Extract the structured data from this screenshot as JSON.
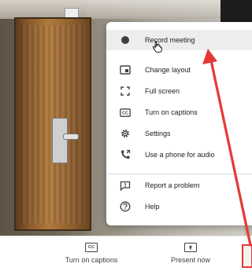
{
  "menu": {
    "items": [
      {
        "label": "Record meeting",
        "icon": "record-dot-icon"
      },
      {
        "label": "Change layout",
        "icon": "layout-icon"
      },
      {
        "label": "Full screen",
        "icon": "fullscreen-icon"
      },
      {
        "label": "Turn on captions",
        "icon": "captions-icon"
      },
      {
        "label": "Settings",
        "icon": "gear-icon"
      },
      {
        "label": "Use a phone for audio",
        "icon": "phone-icon"
      },
      {
        "label": "Report a problem",
        "icon": "report-icon"
      },
      {
        "label": "Help",
        "icon": "help-icon"
      }
    ]
  },
  "bottombar": {
    "captions_label": "Turn on captions",
    "captions_icon_text": "CC",
    "present_label": "Present now"
  },
  "colors": {
    "annotation_red": "#e53935",
    "hover_bg": "#ededed"
  }
}
